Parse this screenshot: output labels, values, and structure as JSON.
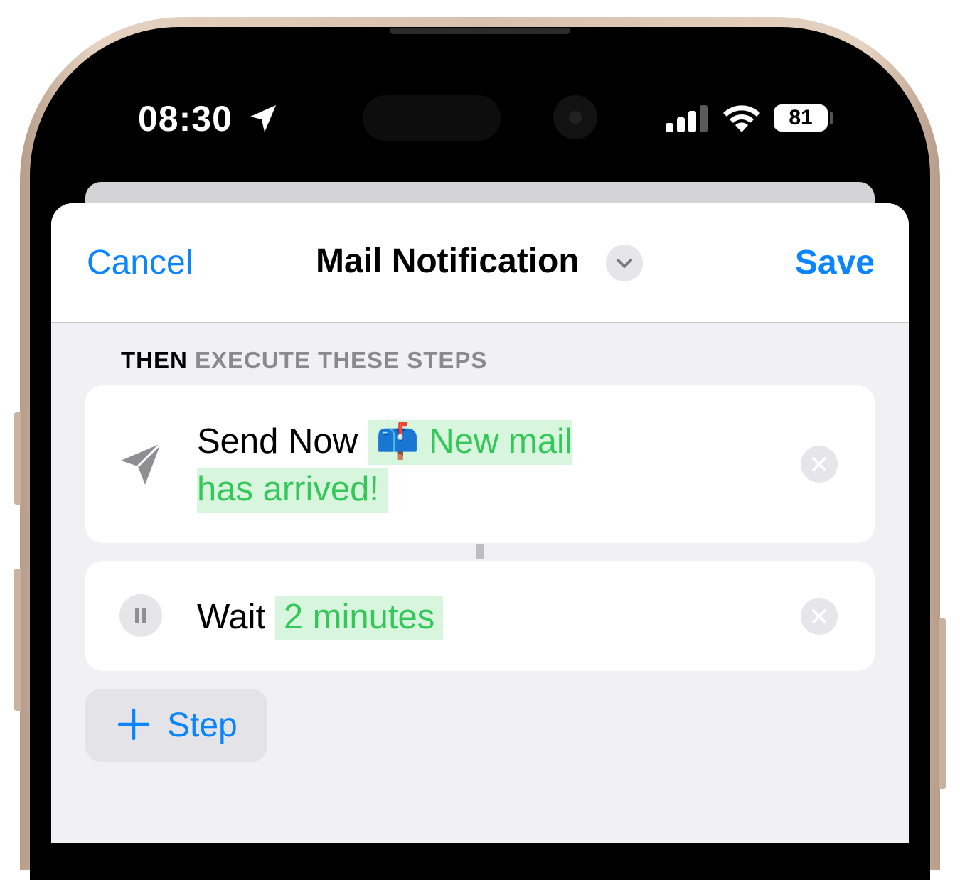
{
  "status_bar": {
    "time": "08:30",
    "battery": "81",
    "icons": [
      "location-arrow-icon",
      "cellular-signal-icon",
      "wifi-icon",
      "battery-icon"
    ]
  },
  "nav": {
    "cancel_label": "Cancel",
    "title": "Mail Notification",
    "title_menu_icon": "chevron-down-icon",
    "save_label": "Save"
  },
  "section": {
    "then": "THEN",
    "rest": "EXECUTE THESE STEPS"
  },
  "steps": [
    {
      "icon": "paper-plane-icon",
      "action": "Send Now",
      "message_emoji": "📫",
      "message": "New mail has arrived!",
      "remove_icon": "close-circle-icon"
    },
    {
      "icon": "pause-icon",
      "action": "Wait",
      "duration": "2 minutes",
      "remove_icon": "close-circle-icon"
    }
  ],
  "add_step": {
    "icon": "plus-icon",
    "label": "Step"
  },
  "colors": {
    "accent": "#0a84ff",
    "token_text": "#34c759",
    "token_bg": "#d8f5dd",
    "sheet_bg": "#f1f1f5"
  }
}
